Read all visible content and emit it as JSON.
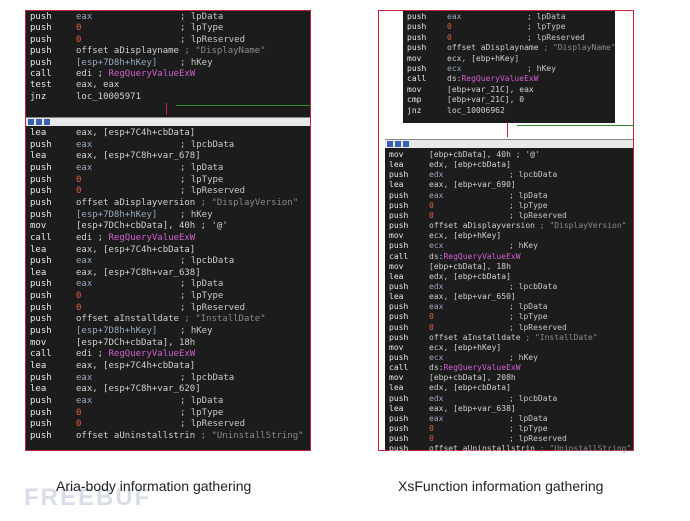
{
  "left": {
    "top_block": [
      {
        "m": "push",
        "o": [
          [
            "eax",
            "reg"
          ]
        ],
        "c": "; lpData"
      },
      {
        "m": "push",
        "o": [
          [
            "0",
            "zero"
          ]
        ],
        "c": "; lpType"
      },
      {
        "m": "push",
        "o": [
          [
            "0",
            "zero"
          ]
        ],
        "c": "; lpReserved"
      },
      {
        "m": "push",
        "o": [
          [
            "offset aDisplayname",
            "kw"
          ],
          [
            " ; \"DisplayName\"",
            "str"
          ]
        ],
        "c": ""
      },
      {
        "m": "push",
        "o": [
          [
            "[esp+7D8h+hKey]",
            "reg"
          ]
        ],
        "c": "; hKey"
      },
      {
        "m": "call",
        "o": [
          [
            "edi ; ",
            "kw"
          ],
          [
            "RegQueryValueExW",
            "fn"
          ]
        ],
        "c": ""
      },
      {
        "m": "test",
        "o": [
          [
            "eax, eax",
            "kw"
          ]
        ],
        "c": ""
      },
      {
        "m": "jnz",
        "o": [
          [
            "loc_10005971",
            "kw"
          ]
        ],
        "c": ""
      }
    ],
    "bottom_block": [
      {
        "m": "lea",
        "o": [
          [
            "eax, [esp+7C4h+cbData]",
            "kw"
          ]
        ],
        "c": ""
      },
      {
        "m": "push",
        "o": [
          [
            "eax",
            "reg"
          ]
        ],
        "c": "; lpcbData"
      },
      {
        "m": "lea",
        "o": [
          [
            "eax, [esp+7C8h+var_678]",
            "kw"
          ]
        ],
        "c": ""
      },
      {
        "m": "push",
        "o": [
          [
            "eax",
            "reg"
          ]
        ],
        "c": "; lpData"
      },
      {
        "m": "push",
        "o": [
          [
            "0",
            "zero"
          ]
        ],
        "c": "; lpType"
      },
      {
        "m": "push",
        "o": [
          [
            "0",
            "zero"
          ]
        ],
        "c": "; lpReserved"
      },
      {
        "m": "push",
        "o": [
          [
            "offset aDisplayversion",
            "kw"
          ],
          [
            " ; \"DisplayVersion\"",
            "str"
          ]
        ],
        "c": ""
      },
      {
        "m": "push",
        "o": [
          [
            "[esp+7D8h+hKey]",
            "reg"
          ]
        ],
        "c": "; hKey"
      },
      {
        "m": "mov",
        "o": [
          [
            "[esp+7DCh+cbData], 40h ; '@'",
            "kw"
          ]
        ],
        "c": ""
      },
      {
        "m": "call",
        "o": [
          [
            "edi ; ",
            "kw"
          ],
          [
            "RegQueryValueExW",
            "fn"
          ]
        ],
        "c": ""
      },
      {
        "m": "lea",
        "o": [
          [
            "eax, [esp+7C4h+cbData]",
            "kw"
          ]
        ],
        "c": ""
      },
      {
        "m": "push",
        "o": [
          [
            "eax",
            "reg"
          ]
        ],
        "c": "; lpcbData"
      },
      {
        "m": "lea",
        "o": [
          [
            "eax, [esp+7C8h+var_638]",
            "kw"
          ]
        ],
        "c": ""
      },
      {
        "m": "push",
        "o": [
          [
            "eax",
            "reg"
          ]
        ],
        "c": "; lpData"
      },
      {
        "m": "push",
        "o": [
          [
            "0",
            "zero"
          ]
        ],
        "c": "; lpType"
      },
      {
        "m": "push",
        "o": [
          [
            "0",
            "zero"
          ]
        ],
        "c": "; lpReserved"
      },
      {
        "m": "push",
        "o": [
          [
            "offset aInstalldate",
            "kw"
          ],
          [
            " ; \"InstallDate\"",
            "str"
          ]
        ],
        "c": ""
      },
      {
        "m": "push",
        "o": [
          [
            "[esp+7D8h+hKey]",
            "reg"
          ]
        ],
        "c": "; hKey"
      },
      {
        "m": "mov",
        "o": [
          [
            "[esp+7DCh+cbData], 18h",
            "kw"
          ]
        ],
        "c": ""
      },
      {
        "m": "call",
        "o": [
          [
            "edi ; ",
            "kw"
          ],
          [
            "RegQueryValueExW",
            "fn"
          ]
        ],
        "c": ""
      },
      {
        "m": "lea",
        "o": [
          [
            "eax, [esp+7C4h+cbData]",
            "kw"
          ]
        ],
        "c": ""
      },
      {
        "m": "push",
        "o": [
          [
            "eax",
            "reg"
          ]
        ],
        "c": "; lpcbData"
      },
      {
        "m": "lea",
        "o": [
          [
            "eax, [esp+7C8h+var_620]",
            "kw"
          ]
        ],
        "c": ""
      },
      {
        "m": "push",
        "o": [
          [
            "eax",
            "reg"
          ]
        ],
        "c": "; lpData"
      },
      {
        "m": "push",
        "o": [
          [
            "0",
            "zero"
          ]
        ],
        "c": "; lpType"
      },
      {
        "m": "push",
        "o": [
          [
            "0",
            "zero"
          ]
        ],
        "c": "; lpReserved"
      },
      {
        "m": "push",
        "o": [
          [
            "offset aUninstallstrin",
            "kw"
          ],
          [
            " ; \"UninstallString\"",
            "str"
          ]
        ],
        "c": ""
      }
    ]
  },
  "right": {
    "top_block": [
      {
        "m": "push",
        "o": [
          [
            "eax",
            "reg"
          ]
        ],
        "c": "; lpData"
      },
      {
        "m": "push",
        "o": [
          [
            "0",
            "zero"
          ]
        ],
        "c": "; lpType"
      },
      {
        "m": "push",
        "o": [
          [
            "0",
            "zero"
          ]
        ],
        "c": "; lpReserved"
      },
      {
        "m": "push",
        "o": [
          [
            "offset aDisplayname",
            "kw"
          ],
          [
            " ; \"DisplayName\"",
            "str"
          ]
        ],
        "c": ""
      },
      {
        "m": "mov",
        "o": [
          [
            "ecx, [ebp+hKey]",
            "kw"
          ]
        ],
        "c": ""
      },
      {
        "m": "push",
        "o": [
          [
            "ecx",
            "reg"
          ]
        ],
        "c": "; hKey"
      },
      {
        "m": "call",
        "o": [
          [
            "ds:",
            "kw"
          ],
          [
            "RegQueryValueExW",
            "fn"
          ]
        ],
        "c": ""
      },
      {
        "m": "mov",
        "o": [
          [
            "[ebp+var_21C], eax",
            "kw"
          ]
        ],
        "c": ""
      },
      {
        "m": "cmp",
        "o": [
          [
            "[ebp+var_21C], 0",
            "kw"
          ]
        ],
        "c": ""
      },
      {
        "m": "jnz",
        "o": [
          [
            "loc_10006962",
            "kw"
          ]
        ],
        "c": ""
      }
    ],
    "bottom_block": [
      {
        "m": "mov",
        "o": [
          [
            "[ebp+cbData], 40h ; '@'",
            "kw"
          ]
        ],
        "c": ""
      },
      {
        "m": "lea",
        "o": [
          [
            "edx, [ebp+cbData]",
            "kw"
          ]
        ],
        "c": ""
      },
      {
        "m": "push",
        "o": [
          [
            "edx",
            "reg"
          ]
        ],
        "c": "; lpcbData"
      },
      {
        "m": "lea",
        "o": [
          [
            "eax, [ebp+var_690]",
            "kw"
          ]
        ],
        "c": ""
      },
      {
        "m": "push",
        "o": [
          [
            "eax",
            "reg"
          ]
        ],
        "c": "; lpData"
      },
      {
        "m": "push",
        "o": [
          [
            "0",
            "zero"
          ]
        ],
        "c": "; lpType"
      },
      {
        "m": "push",
        "o": [
          [
            "0",
            "zero"
          ]
        ],
        "c": "; lpReserved"
      },
      {
        "m": "push",
        "o": [
          [
            "offset aDisplayversion",
            "kw"
          ],
          [
            " ; \"DisplayVersion\"",
            "str"
          ]
        ],
        "c": ""
      },
      {
        "m": "mov",
        "o": [
          [
            "ecx, [ebp+hKey]",
            "kw"
          ]
        ],
        "c": ""
      },
      {
        "m": "push",
        "o": [
          [
            "ecx",
            "reg"
          ]
        ],
        "c": "; hKey"
      },
      {
        "m": "call",
        "o": [
          [
            "ds:",
            "kw"
          ],
          [
            "RegQueryValueExW",
            "fn"
          ]
        ],
        "c": ""
      },
      {
        "m": "mov",
        "o": [
          [
            "[ebp+cbData], 18h",
            "kw"
          ]
        ],
        "c": ""
      },
      {
        "m": "lea",
        "o": [
          [
            "edx, [ebp+cbData]",
            "kw"
          ]
        ],
        "c": ""
      },
      {
        "m": "push",
        "o": [
          [
            "edx",
            "reg"
          ]
        ],
        "c": "; lpcbData"
      },
      {
        "m": "lea",
        "o": [
          [
            "eax, [ebp+var_650]",
            "kw"
          ]
        ],
        "c": ""
      },
      {
        "m": "push",
        "o": [
          [
            "eax",
            "reg"
          ]
        ],
        "c": "; lpData"
      },
      {
        "m": "push",
        "o": [
          [
            "0",
            "zero"
          ]
        ],
        "c": "; lpType"
      },
      {
        "m": "push",
        "o": [
          [
            "0",
            "zero"
          ]
        ],
        "c": "; lpReserved"
      },
      {
        "m": "push",
        "o": [
          [
            "offset aInstalldate",
            "kw"
          ],
          [
            " ; \"InstallDate\"",
            "str"
          ]
        ],
        "c": ""
      },
      {
        "m": "mov",
        "o": [
          [
            "ecx, [ebp+hKey]",
            "kw"
          ]
        ],
        "c": ""
      },
      {
        "m": "push",
        "o": [
          [
            "ecx",
            "reg"
          ]
        ],
        "c": "; hKey"
      },
      {
        "m": "call",
        "o": [
          [
            "ds:",
            "kw"
          ],
          [
            "RegQueryValueExW",
            "fn"
          ]
        ],
        "c": ""
      },
      {
        "m": "mov",
        "o": [
          [
            "[ebp+cbData], 208h",
            "kw"
          ]
        ],
        "c": ""
      },
      {
        "m": "lea",
        "o": [
          [
            "edx, [ebp+cbData]",
            "kw"
          ]
        ],
        "c": ""
      },
      {
        "m": "push",
        "o": [
          [
            "edx",
            "reg"
          ]
        ],
        "c": "; lpcbData"
      },
      {
        "m": "lea",
        "o": [
          [
            "eax, [ebp+var_638]",
            "kw"
          ]
        ],
        "c": ""
      },
      {
        "m": "push",
        "o": [
          [
            "eax",
            "reg"
          ]
        ],
        "c": "; lpData"
      },
      {
        "m": "push",
        "o": [
          [
            "0",
            "zero"
          ]
        ],
        "c": "; lpType"
      },
      {
        "m": "push",
        "o": [
          [
            "0",
            "zero"
          ]
        ],
        "c": "; lpReserved"
      },
      {
        "m": "push",
        "o": [
          [
            "offset aUninstallstrin",
            "kw"
          ],
          [
            " ; \"UninstallString\"",
            "str"
          ]
        ],
        "c": ""
      }
    ]
  },
  "captions": {
    "left": "Aria-body information gathering",
    "right": "XsFunction information gathering"
  },
  "watermark": "FREEBUF",
  "icons": [
    "graph-node-header-icon"
  ],
  "colors": {
    "border": "#c0283a",
    "edge": "#2a8a2a",
    "bg": "#1c1c1c",
    "func": "#d060d0"
  }
}
